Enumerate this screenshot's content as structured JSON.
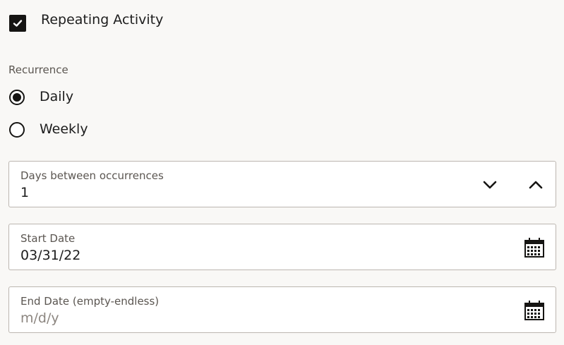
{
  "repeating": {
    "label": "Repeating Activity",
    "checked": true
  },
  "recurrence": {
    "label": "Recurrence",
    "options": [
      {
        "label": "Daily",
        "selected": true
      },
      {
        "label": "Weekly",
        "selected": false
      }
    ]
  },
  "days_between": {
    "label": "Days between occurrences",
    "value": "1"
  },
  "start_date": {
    "label": "Start Date",
    "value": "03/31/22"
  },
  "end_date": {
    "label": "End Date (empty-endless)",
    "placeholder": "m/d/y",
    "value": ""
  },
  "icons": {
    "checkbox": "check-icon",
    "decrement": "chevron-down-icon",
    "increment": "chevron-up-icon",
    "calendar": "calendar-icon"
  },
  "colors": {
    "control": "#161513",
    "border": "#bcb6b0",
    "background": "#f9f8f6",
    "label": "#5b5651"
  }
}
